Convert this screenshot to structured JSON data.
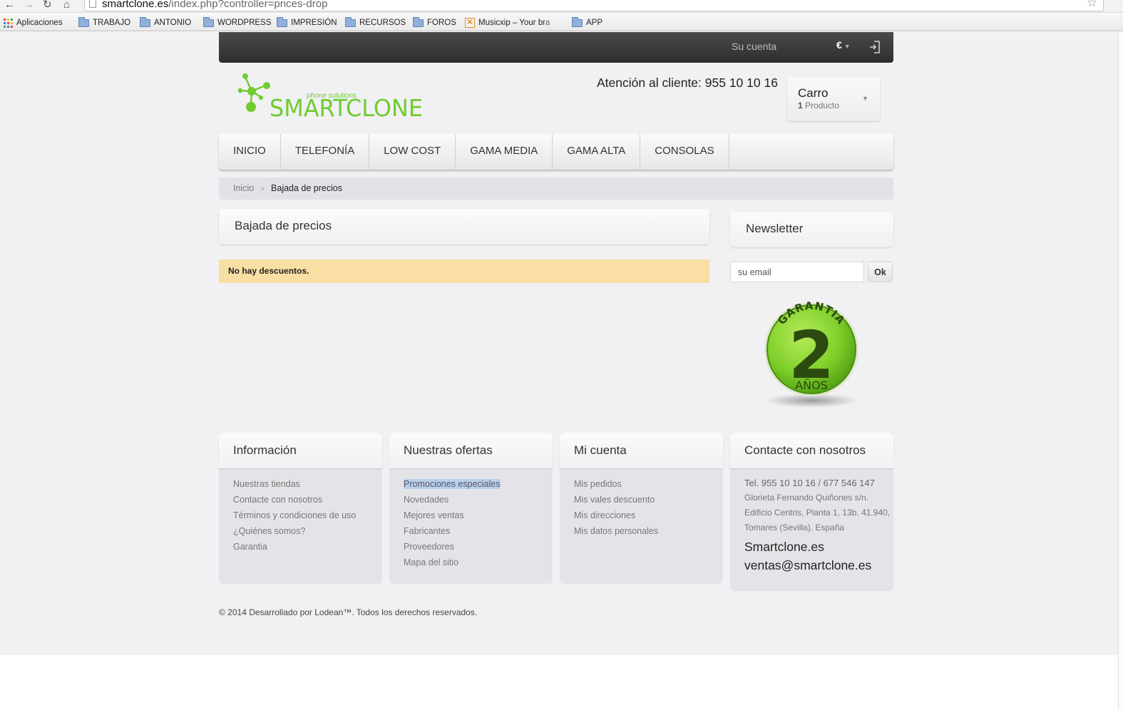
{
  "browser": {
    "url_host": "smartclone.es",
    "url_path": "/index.php?controller=prices-drop",
    "bookmarks": [
      {
        "label": "Aplicaciones",
        "icon": "apps-icon"
      },
      {
        "label": "TRABAJO",
        "icon": "folder-icon"
      },
      {
        "label": "ANTONIO",
        "icon": "folder-icon"
      },
      {
        "label": "WORDPRESS",
        "icon": "folder-icon"
      },
      {
        "label": "IMPRESIÓN",
        "icon": "folder-icon"
      },
      {
        "label": "RECURSOS",
        "icon": "folder-icon"
      },
      {
        "label": "FOROS",
        "icon": "folder-icon"
      },
      {
        "label": "Musicxip – Your bra",
        "icon": "musicxip-icon"
      },
      {
        "label": "APP",
        "icon": "folder-icon"
      }
    ]
  },
  "topbar": {
    "account": "Su cuenta",
    "currency": "€"
  },
  "header": {
    "logo_tagline": "phone solutions",
    "logo_name": "SMARTCLONE",
    "phone_line": "Atención al cliente: 955 10 10 16",
    "cart": {
      "title": "Carro",
      "count": "1",
      "unit": "Producto"
    }
  },
  "menu": [
    "INICIO",
    "TELEFONÍA",
    "LOW COST",
    "GAMA MEDIA",
    "GAMA ALTA",
    "CONSOLAS"
  ],
  "breadcrumb": {
    "home": "Inicio",
    "separator": ">",
    "current": "Bajada de precios"
  },
  "main": {
    "title": "Bajada de precios",
    "alert": "No hay descuentos."
  },
  "sidebar": {
    "newsletter_title": "Newsletter",
    "email_placeholder": "su email",
    "ok_label": "Ok",
    "badge": {
      "top": "GARANTIA",
      "number": "2",
      "bottom": "AÑOS"
    }
  },
  "footer": {
    "info": {
      "title": "Información",
      "items": [
        "Nuestras tiendas",
        "Contacte con nosotros",
        "Términos y condiciones de uso",
        "¿Quiénes somos?",
        "Garantia"
      ]
    },
    "offers": {
      "title": "Nuestras ofertas",
      "items": [
        "Promociones especiales",
        "Novedades",
        "Mejores ventas",
        "Fabricantes",
        "Proveedores",
        "Mapa del sitio"
      ]
    },
    "account": {
      "title": "Mi cuenta",
      "items": [
        "Mis pedidos",
        "Mis vales descuento",
        "Mis direcciones",
        "Mis datos personales"
      ]
    },
    "contact": {
      "title": "Contacte con nosotros",
      "tel": "Tel. 955 10 10 16 / 677 546 147",
      "address": [
        "Glorieta Fernando Quiñones s/n.",
        "Edificio Centris, Planta 1, 13b. 41.940,",
        "Tomares (Sevilla). España"
      ],
      "site": "Smartclone.es",
      "email": "ventas@smartclone.es"
    },
    "copyright": "© 2014 Desarrollado por Lodean™. Todos los derechos reservados."
  },
  "colors": {
    "brand_green": "#6fcc2e",
    "alert_bg": "#f9dfa3",
    "topbar_bg": "#3a3a3a",
    "page_bg": "#f1f1f3"
  }
}
